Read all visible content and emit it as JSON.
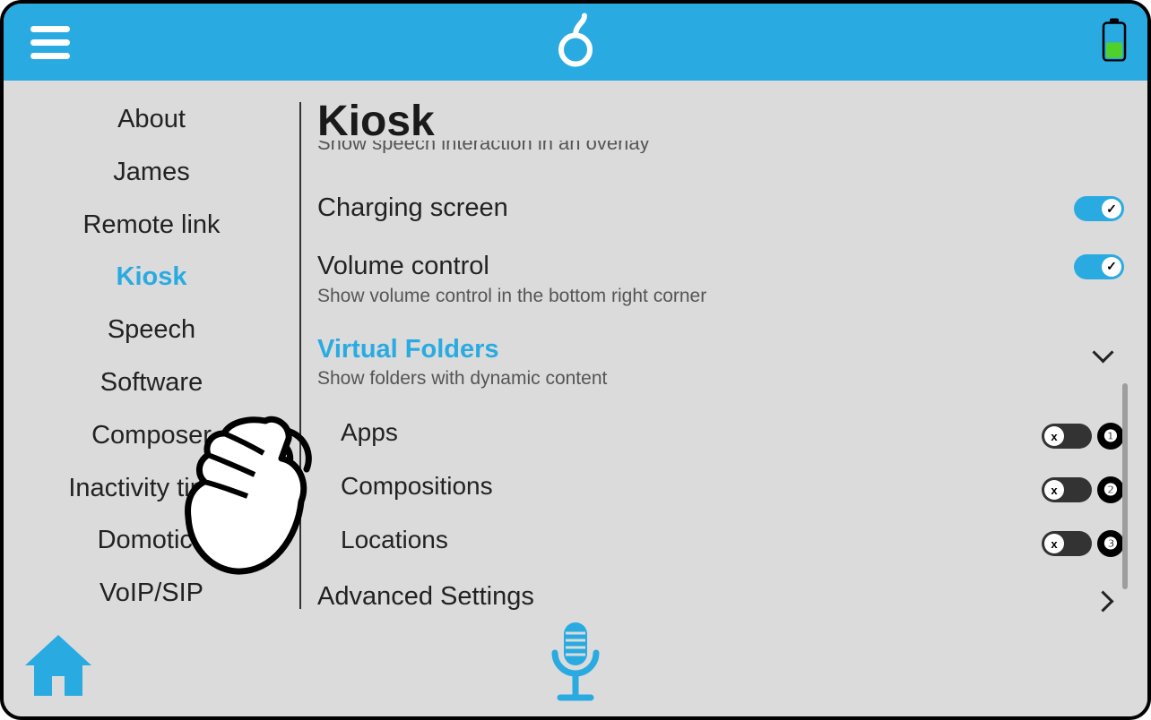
{
  "colors": {
    "accent": "#29abe2"
  },
  "sidebar": {
    "items": [
      {
        "label": "About",
        "active": false
      },
      {
        "label": "James",
        "active": false
      },
      {
        "label": "Remote link",
        "active": false
      },
      {
        "label": "Kiosk",
        "active": true
      },
      {
        "label": "Speech",
        "active": false
      },
      {
        "label": "Software",
        "active": false
      },
      {
        "label": "Composer",
        "active": false
      },
      {
        "label": "Inactivity timer",
        "active": false
      },
      {
        "label": "Domotics",
        "active": false
      },
      {
        "label": "VoIP/SIP",
        "active": false
      }
    ]
  },
  "content": {
    "title": "Kiosk",
    "truncated_prev_subtitle": "Show speech interaction in an overlay",
    "items": [
      {
        "key": "charging",
        "label": "Charging screen",
        "kind": "toggle",
        "on": true
      },
      {
        "key": "volume",
        "label": "Volume control",
        "subtitle": "Show volume control in the bottom right corner",
        "kind": "toggle",
        "on": true
      },
      {
        "key": "vfolders",
        "label": "Virtual Folders",
        "subtitle": "Show folders with dynamic content",
        "kind": "expand",
        "highlight": true,
        "children": [
          {
            "key": "apps",
            "label": "Apps",
            "kind": "toggle",
            "on": false,
            "badge": "❶"
          },
          {
            "key": "compositions",
            "label": "Compositions",
            "kind": "toggle",
            "on": false,
            "badge": "❷"
          },
          {
            "key": "locations",
            "label": "Locations",
            "kind": "toggle",
            "on": false,
            "badge": "❸"
          }
        ]
      },
      {
        "key": "advanced",
        "label": "Advanced Settings",
        "kind": "nav"
      }
    ]
  },
  "battery_level_pct": 50
}
